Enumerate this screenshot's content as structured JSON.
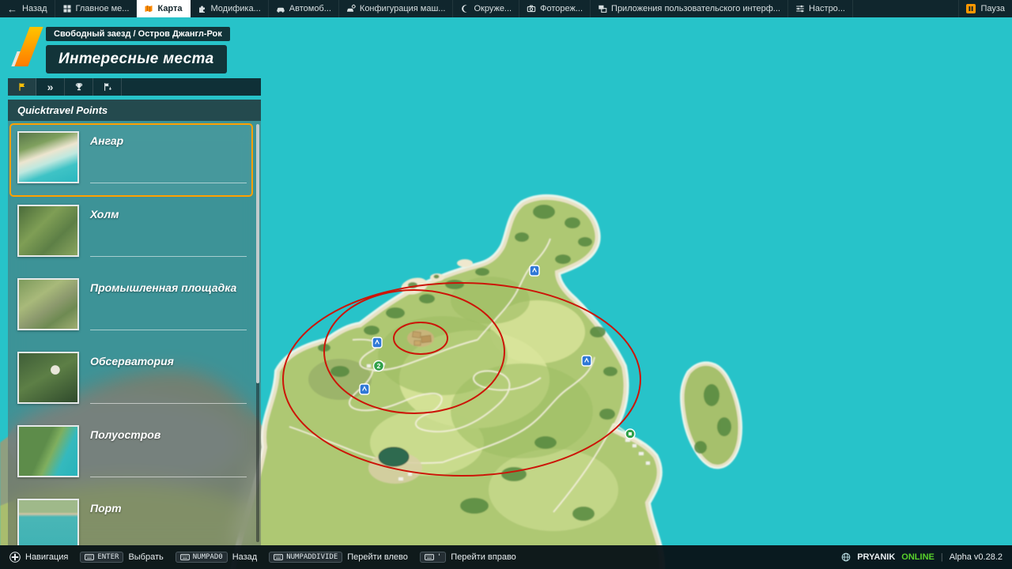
{
  "topbar": {
    "back_icon": "←",
    "back_label": "Назад",
    "tabs": [
      {
        "label": "Главное ме..."
      },
      {
        "label": "Карта"
      },
      {
        "label": "Модифика..."
      },
      {
        "label": "Автомоб..."
      },
      {
        "label": "Конфигурация маш..."
      },
      {
        "label": "Окруже..."
      },
      {
        "label": "Фотореж..."
      },
      {
        "label": "Приложения пользовательского интерф..."
      },
      {
        "label": "Настро..."
      }
    ],
    "pause_label": "Пауза"
  },
  "header": {
    "breadcrumb": "Свободный заезд / Остров Джангл-Рок",
    "title": "Интересные места"
  },
  "subtabs": {
    "chevrons_glyph": "»"
  },
  "panel": {
    "header": "Quicktravel Points",
    "items": [
      {
        "label": "Ангар"
      },
      {
        "label": "Холм"
      },
      {
        "label": "Промышленная площадка"
      },
      {
        "label": "Обсерватория"
      },
      {
        "label": "Полуостров"
      },
      {
        "label": "Порт"
      }
    ]
  },
  "map": {
    "badge": "2"
  },
  "footer": {
    "hints": [
      {
        "key": "",
        "label": "Навигация"
      },
      {
        "key": "ENTER",
        "label": "Выбрать"
      },
      {
        "key": "NUMPAD0",
        "label": "Назад"
      },
      {
        "key": "NUMPADDIVIDE",
        "label": "Перейти влево"
      },
      {
        "key": "'",
        "label": "Перейти вправо"
      }
    ],
    "player": "PRYANIK",
    "status": "ONLINE",
    "version": "Alpha v0.28.2"
  },
  "colors": {
    "accent_orange": "#ff9800",
    "water": "#27c3c9",
    "highlight_red": "#cc1508",
    "online_green": "#58d12b"
  }
}
